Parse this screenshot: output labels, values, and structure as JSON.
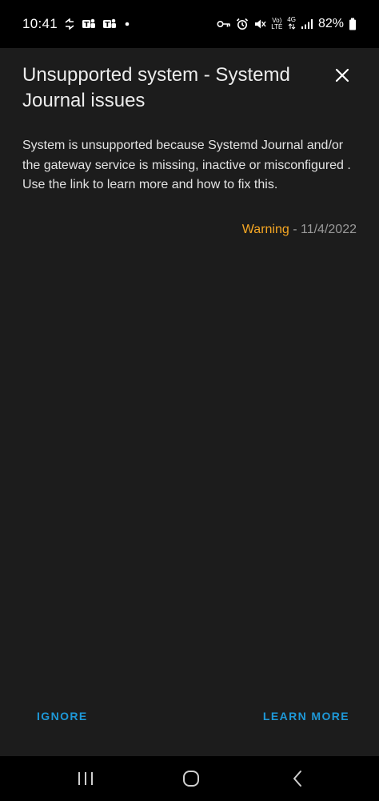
{
  "status_bar": {
    "time": "10:41",
    "network_top": "Vo)",
    "network_bottom": "LTE",
    "signal_gen": "4G",
    "battery": "82%",
    "icons": [
      "sync-icon",
      "teams-icon",
      "teams-icon",
      "notification-dot-icon",
      "key-icon",
      "alarm-icon",
      "mute-icon",
      "volte-icon",
      "data-arrows-icon",
      "signal-icon",
      "battery-icon"
    ]
  },
  "dialog": {
    "title": "Unsupported system - Systemd Journal issues",
    "body": "System is unsupported because Systemd Journal and/or the gateway service is missing, inactive or misconfigured . Use the link to learn more and how to fix this.",
    "severity": "Warning",
    "separator": " - ",
    "date": "11/4/2022",
    "close_icon": "close-icon"
  },
  "actions": {
    "ignore_label": "IGNORE",
    "learn_more_label": "LEARN MORE"
  },
  "colors": {
    "background": "#1c1c1c",
    "accent": "#1e98d7",
    "warning": "#f5a623",
    "muted": "#9a9a9a"
  },
  "nav_bar": {
    "icons": [
      "recents-icon",
      "home-icon",
      "back-icon"
    ]
  }
}
